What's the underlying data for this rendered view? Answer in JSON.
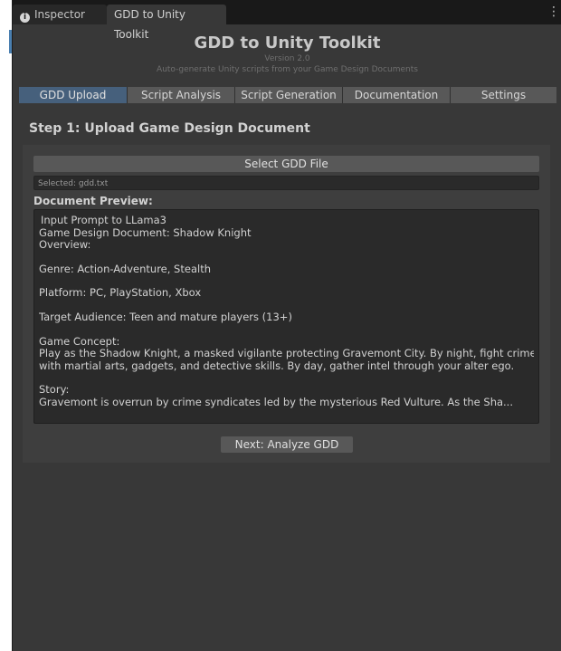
{
  "tabs": {
    "inspector_label": "Inspector",
    "toolkit_label": "GDD to Unity Toolkit",
    "menu_glyph": "⋮"
  },
  "header": {
    "title": "GDD to Unity Toolkit",
    "version": "Version 2.0",
    "subtitle": "Auto-generate Unity scripts from your Game Design Documents"
  },
  "toolbar": {
    "items": [
      {
        "label": "GDD Upload",
        "active": true
      },
      {
        "label": "Script Analysis",
        "active": false
      },
      {
        "label": "Script Generation",
        "active": false
      },
      {
        "label": "Documentation",
        "active": false
      },
      {
        "label": "Settings",
        "active": false
      }
    ]
  },
  "upload": {
    "step_title": "Step 1: Upload Game Design Document",
    "select_button": "Select GDD File",
    "selected_text": "Selected: gdd.txt",
    "preview_label": "Document Preview:",
    "preview_lines": [
      "Input Prompt to LLama3",
      "Game Design Document: Shadow Knight",
      "Overview:",
      "",
      "Genre: Action-Adventure, Stealth",
      "",
      "Platform: PC, PlayStation, Xbox",
      "",
      "Target Audience: Teen and mature players (13+)",
      "",
      "Game Concept:",
      "Play as the Shadow Knight, a masked vigilante protecting Gravemont City. By night, fight crime",
      "with martial arts, gadgets, and detective skills. By day, gather intel through your alter ego.",
      "",
      "Story:",
      "Gravemont is overrun by crime syndicates led by the mysterious Red Vulture. As the Sha..."
    ],
    "next_button": "Next: Analyze GDD"
  },
  "colors": {
    "window_bg": "#383838",
    "tabbar_bg": "#191919",
    "active_tab": "#46607c",
    "button_bg": "#585858",
    "field_bg": "#2a2a2a"
  }
}
